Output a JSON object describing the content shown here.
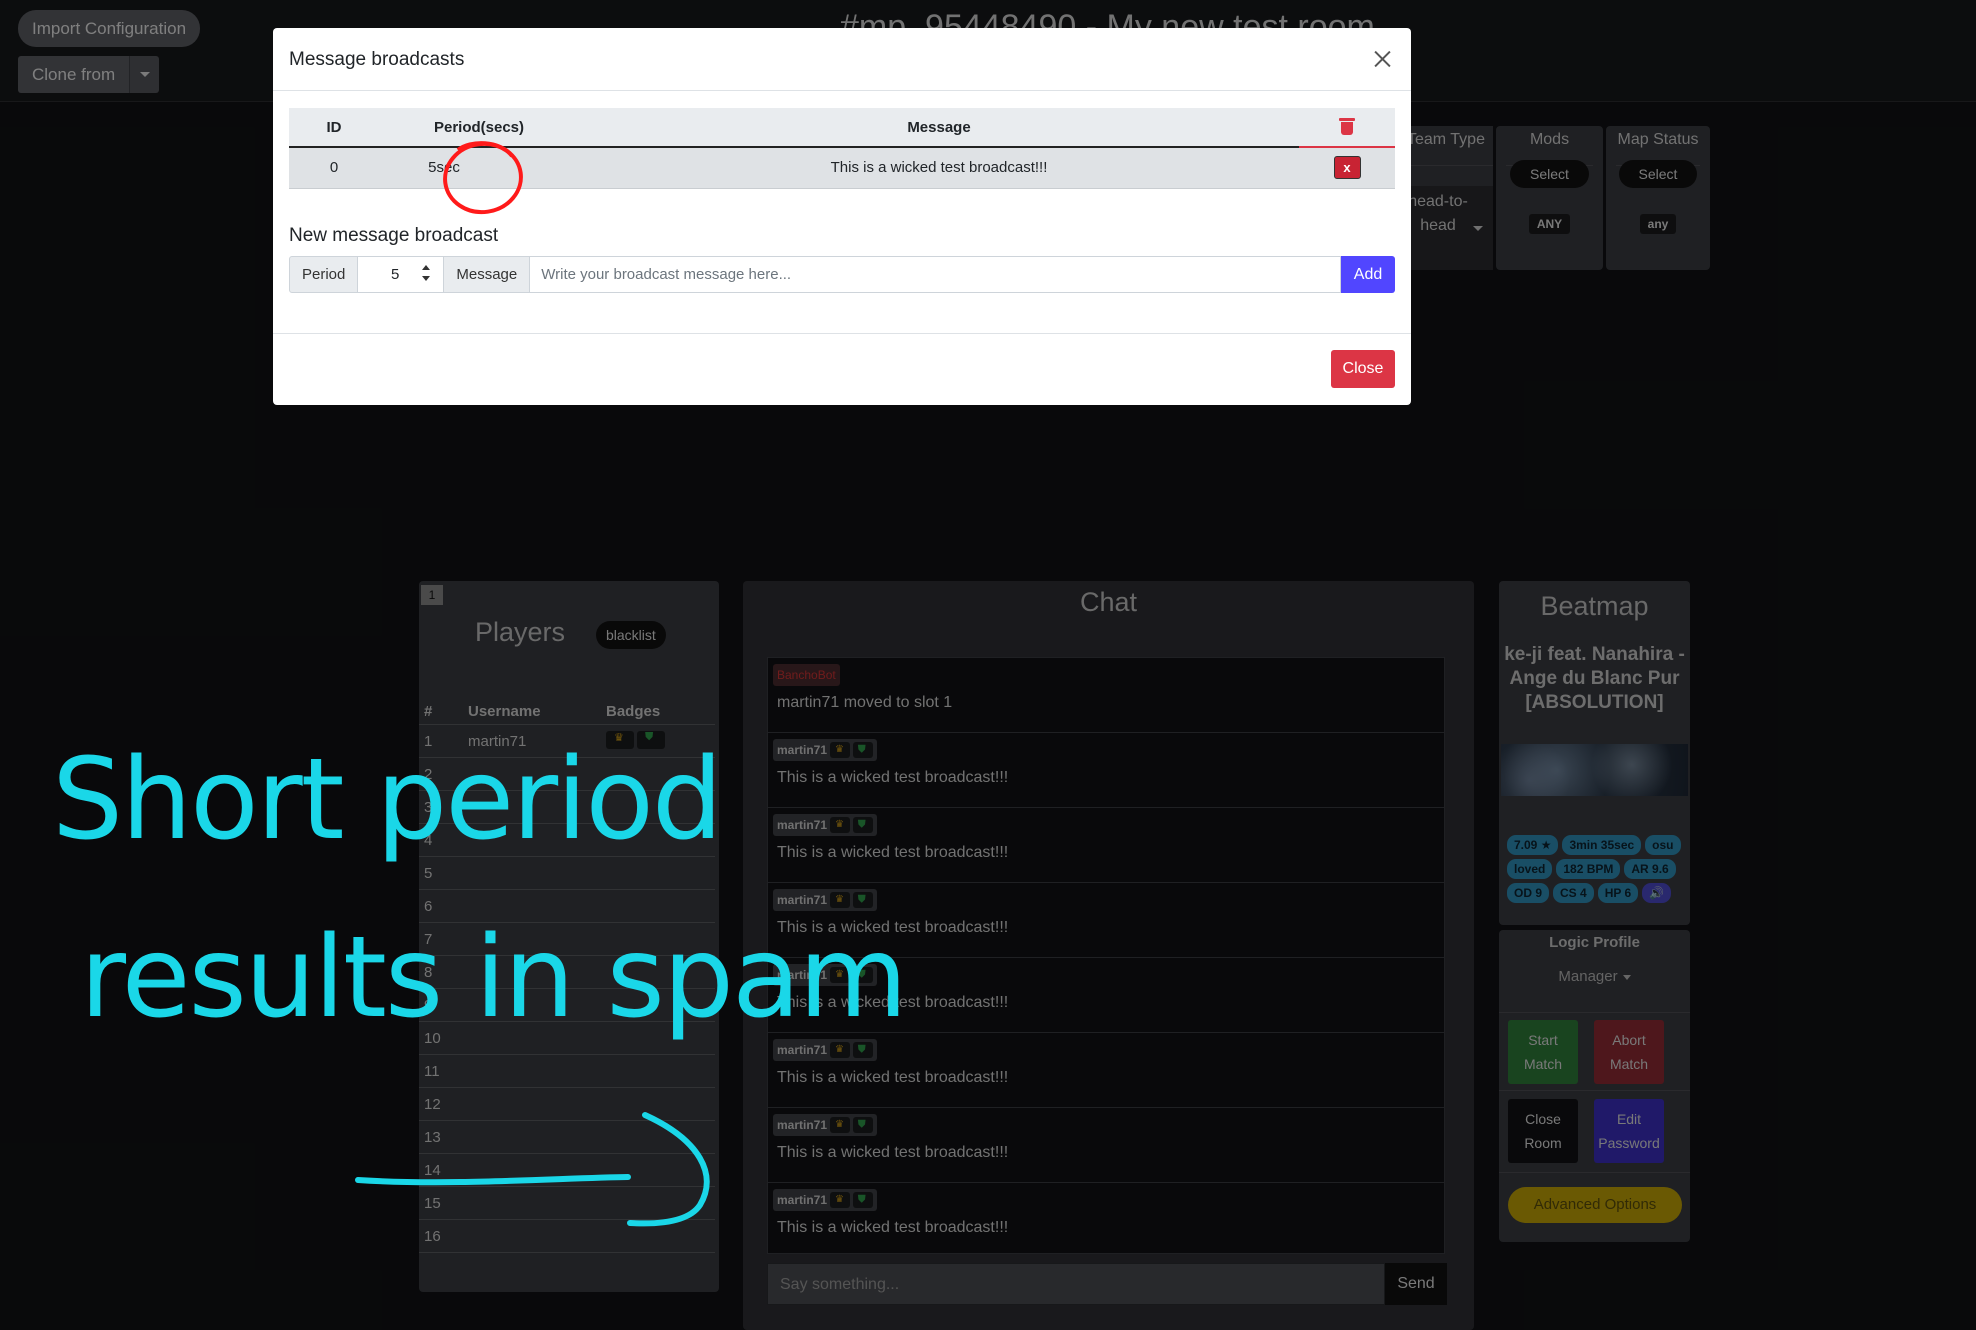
{
  "app": {
    "room_title": "#mp_95448490 - My new test room",
    "import_button": "Import Configuration",
    "clone_button": "Clone from"
  },
  "settings": {
    "team_type": {
      "header": "Team Type",
      "value": "head-to-head"
    },
    "mods": {
      "header": "Mods",
      "select": "Select",
      "tag": "ANY"
    },
    "map_status": {
      "header": "Map Status",
      "select": "Select",
      "tag": "any"
    }
  },
  "players": {
    "slot_badge": "1",
    "title": "Players",
    "blacklist_button": "blacklist",
    "columns": [
      "#",
      "Username",
      "Badges"
    ],
    "rows": [
      {
        "num": "1",
        "username": "martin71",
        "has_badges": true
      },
      {
        "num": "2",
        "username": ""
      },
      {
        "num": "3",
        "username": ""
      },
      {
        "num": "4",
        "username": ""
      },
      {
        "num": "5",
        "username": ""
      },
      {
        "num": "6",
        "username": ""
      },
      {
        "num": "7",
        "username": ""
      },
      {
        "num": "8",
        "username": ""
      },
      {
        "num": "9",
        "username": ""
      },
      {
        "num": "10",
        "username": ""
      },
      {
        "num": "11",
        "username": ""
      },
      {
        "num": "12",
        "username": ""
      },
      {
        "num": "13",
        "username": ""
      },
      {
        "num": "14",
        "username": ""
      },
      {
        "num": "15",
        "username": ""
      },
      {
        "num": "16",
        "username": ""
      }
    ]
  },
  "chat": {
    "title": "Chat",
    "messages": [
      {
        "sender": "BanchoBot",
        "system": true,
        "text": "martin71 moved to slot 1"
      },
      {
        "sender": "martin71",
        "system": false,
        "text": "This is a wicked test broadcast!!!"
      },
      {
        "sender": "martin71",
        "system": false,
        "text": "This is a wicked test broadcast!!!"
      },
      {
        "sender": "martin71",
        "system": false,
        "text": "This is a wicked test broadcast!!!"
      },
      {
        "sender": "martin71",
        "system": false,
        "text": "This is a wicked test broadcast!!!"
      },
      {
        "sender": "martin71",
        "system": false,
        "text": "This is a wicked test broadcast!!!"
      },
      {
        "sender": "martin71",
        "system": false,
        "text": "This is a wicked test broadcast!!!"
      },
      {
        "sender": "martin71",
        "system": false,
        "text": "This is a wicked test broadcast!!!"
      }
    ],
    "input_placeholder": "Say something...",
    "send_button": "Send"
  },
  "beatmap": {
    "title": "Beatmap",
    "song": "ke-ji feat. Nanahira - Ange du Blanc Pur [ABSOLUTION]",
    "tags": [
      "7.09 ★",
      "3min 35sec",
      "osu",
      "loved",
      "182 BPM",
      "AR 9.6",
      "OD 9",
      "CS 4",
      "HP 6"
    ]
  },
  "logic": {
    "title": "Logic Profile",
    "profile": "Manager",
    "start_match": "Start Match",
    "abort_match": "Abort Match",
    "close_room": "Close Room",
    "edit_password": "Edit Password",
    "advanced_options": "Advanced Options"
  },
  "modal": {
    "title": "Message broadcasts",
    "table": {
      "headers": {
        "id": "ID",
        "period": "Period(secs)",
        "message": "Message"
      },
      "rows": [
        {
          "id": "0",
          "period": "5sec",
          "message": "This is a wicked test broadcast!!!",
          "delete_label": "x"
        }
      ]
    },
    "new_section_title": "New message broadcast",
    "period_label": "Period",
    "period_value": "5",
    "message_label": "Message",
    "message_placeholder": "Write your broadcast message here...",
    "add_button": "Add",
    "close_button": "Close"
  },
  "annotation": {
    "line1": "Short period",
    "line2": "results in spam",
    "color": "#1ad7e8"
  },
  "colors": {
    "danger": "#dc3545",
    "primary": "#5146ff",
    "success": "#2f7d3a",
    "indigo": "#3b2fbf",
    "warning": "#c2a306",
    "info": "#2f8fb9"
  }
}
